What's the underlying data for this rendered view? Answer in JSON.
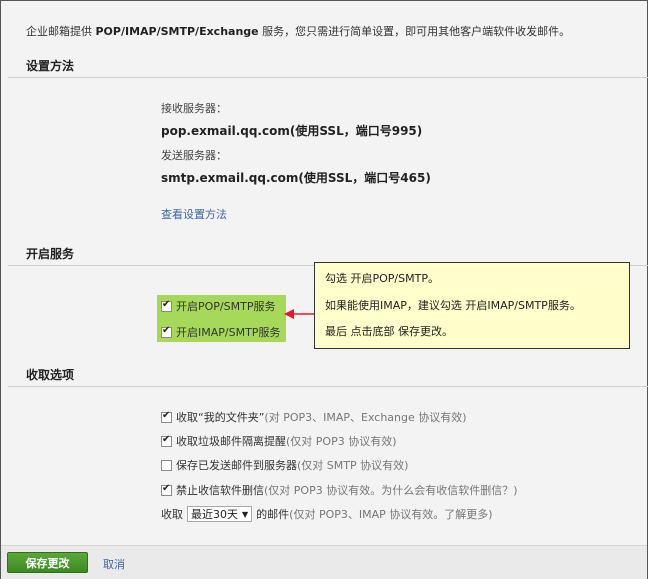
{
  "intro": {
    "prefix": "企业邮箱提供 ",
    "protocols": "POP/IMAP/SMTP/Exchange",
    "suffix": " 服务，您只需进行简单设置，即可用其他客户端软件收发邮件。"
  },
  "setup": {
    "title": "设置方法",
    "incoming_label": "接收服务器：",
    "incoming_server": "pop.exmail.qq.com(使用SSL，端口号995)",
    "outgoing_label": "发送服务器：",
    "outgoing_server": "smtp.exmail.qq.com(使用SSL，端口号465)",
    "view_link": "查看设置方法"
  },
  "services": {
    "title": "开启服务",
    "pop_smtp": {
      "label": "开启POP/SMTP服务",
      "checked": true
    },
    "imap_smtp": {
      "label": "开启IMAP/SMTP服务",
      "checked": true
    }
  },
  "callout": {
    "line1": "勾选 开启POP/SMTP。",
    "line2": "如果能使用IMAP，建议勾选 开启IMAP/SMTP服务。",
    "line3": "最后 点击底部 保存更改。",
    "arrow_color": "#e8192c",
    "background": "#ffffcc"
  },
  "receive": {
    "title": "收取选项",
    "options": [
      {
        "label": "收取“我的文件夹”",
        "note": "(对 POP3、IMAP、Exchange 协议有效)",
        "checked": true
      },
      {
        "label": "收取垃圾邮件隔离提醒",
        "note": "(仅对 POP3 协议有效)",
        "checked": true
      },
      {
        "label": "保存已发送邮件到服务器",
        "note": "(仅对 SMTP 协议有效)",
        "checked": false
      },
      {
        "label": "禁止收信软件删信",
        "note": "(仅对 POP3 协议有效。为什么会有收信软件删信？)",
        "checked": true
      }
    ],
    "range_prefix": "收取",
    "range_value": "最近30天",
    "range_suffix": "的邮件",
    "range_note": "(仅对 POP3、IMAP 协议有效。了解更多)"
  },
  "footer": {
    "save_label": "保存更改",
    "cancel_label": "取消"
  },
  "colors": {
    "accent_green": "#4a9a2f",
    "highlight_green": "#a6d95a",
    "link_blue": "#3a66a7"
  }
}
